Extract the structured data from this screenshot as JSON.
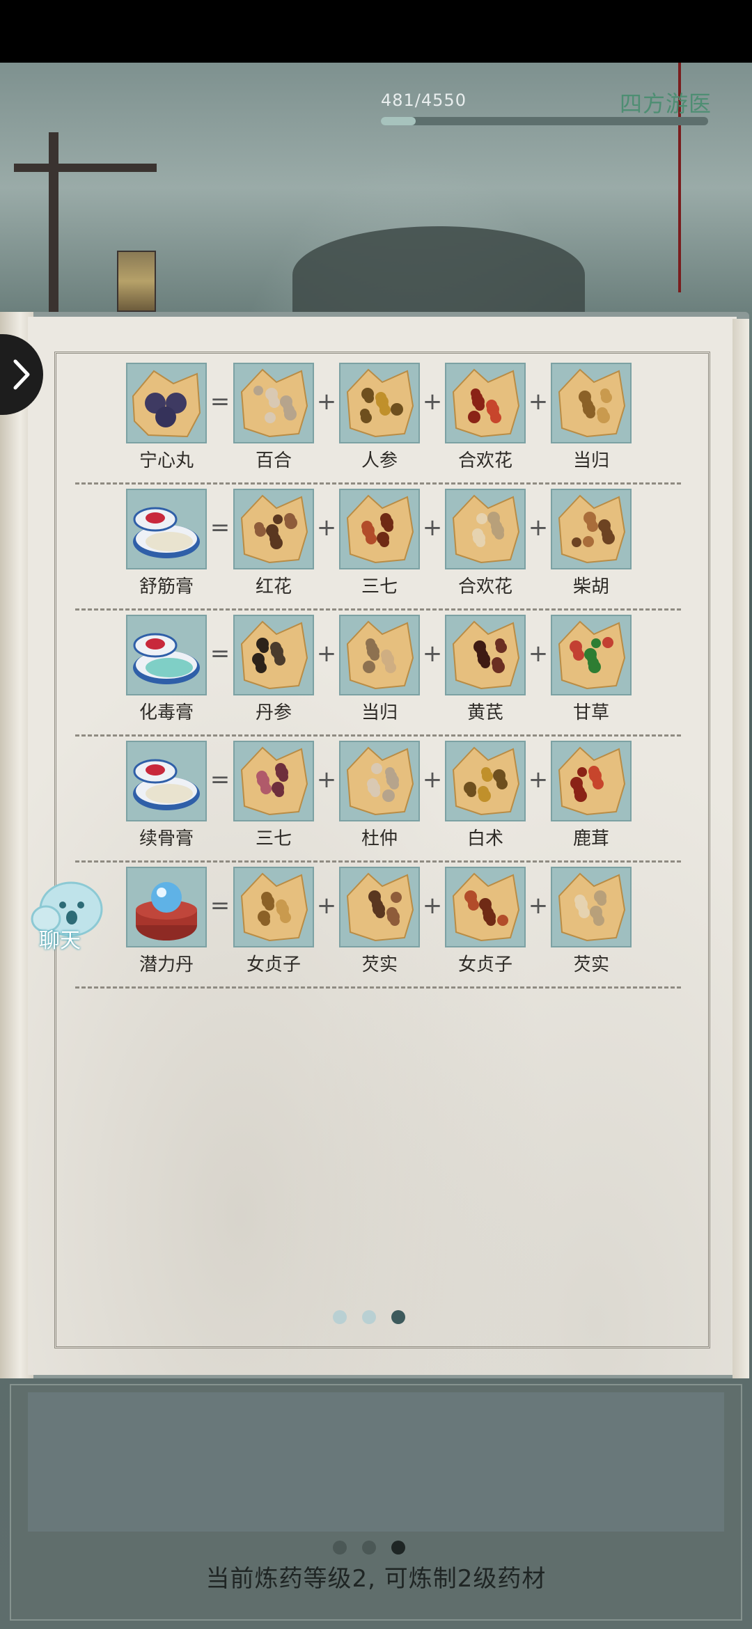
{
  "header": {
    "progress_text": "481/4550",
    "progress_value": 481,
    "progress_max": 4550,
    "location": "四方游医"
  },
  "recipes": [
    {
      "product": "宁心丸",
      "ingredients": [
        "百合",
        "人参",
        "合欢花",
        "当归"
      ]
    },
    {
      "product": "舒筋膏",
      "ingredients": [
        "红花",
        "三七",
        "合欢花",
        "柴胡"
      ]
    },
    {
      "product": "化毒膏",
      "ingredients": [
        "丹参",
        "当归",
        "黄芪",
        "甘草"
      ]
    },
    {
      "product": "续骨膏",
      "ingredients": [
        "三七",
        "杜仲",
        "白术",
        "鹿茸"
      ]
    },
    {
      "product": "潜力丹",
      "ingredients": [
        "女贞子",
        "芡实",
        "女贞子",
        "芡实"
      ]
    }
  ],
  "operators": {
    "equals": "=",
    "plus": "+"
  },
  "chat": {
    "label": "聊天"
  },
  "book_pagination": {
    "total": 3,
    "current": 3
  },
  "lower_pagination": {
    "total": 3,
    "current": 3
  },
  "status_message": "当前炼药等级2, 可炼制2级药材",
  "colors": {
    "tile_bg": "#9fbfc0",
    "location_text": "#4e8e73",
    "active_dot_book": "#3d5a5c",
    "active_dot_lower": "#1e2524"
  }
}
